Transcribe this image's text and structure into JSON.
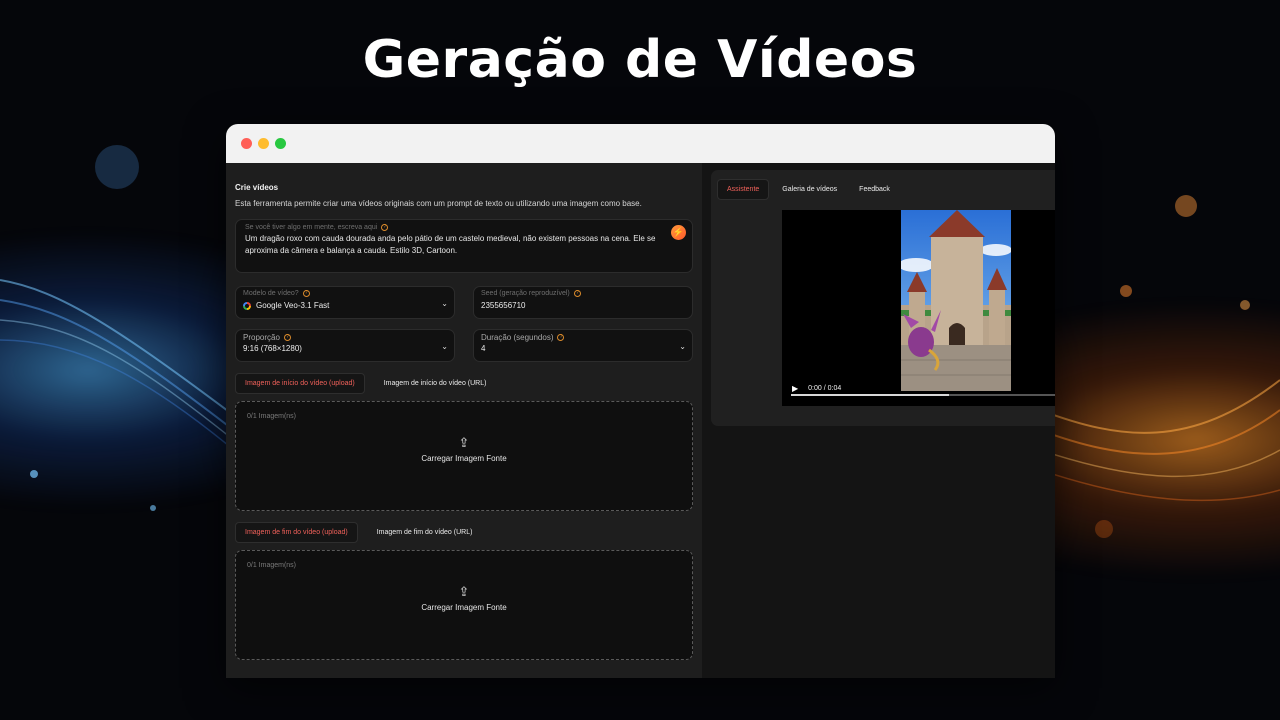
{
  "page": {
    "headline": "Geração de Vídeos"
  },
  "colors": {
    "accent": "#f0615a",
    "background": "#1e1e1e",
    "magic_button": "#ff6a2e"
  },
  "left": {
    "title": "Crie vídeos",
    "description": "Esta ferramenta permite criar uma vídeos originais com um prompt de texto ou utilizando uma imagem como base.",
    "prompt": {
      "label": "Se você tiver algo em mente, escreva aqui",
      "value": "Um dragão roxo com cauda dourada anda pelo pátio de um castelo medieval, não existem pessoas na cena. Ele se aproxima da câmera e balança a cauda. Estilo 3D, Cartoon.",
      "magic_icon": "sparkle-icon"
    },
    "model": {
      "label": "Modelo de vídeo?",
      "value": "Google Veo-3.1 Fast",
      "icon": "google-icon"
    },
    "seed": {
      "label": "Seed (geração reproduzível)",
      "value": "2355656710"
    },
    "ratio": {
      "label": "Proporção",
      "value": "9:16 (768×1280)"
    },
    "duration": {
      "label": "Duração (segundos)",
      "value": "4"
    },
    "start_image": {
      "tab_upload": "Imagem de início do vídeo (upload)",
      "tab_url": "Imagem de início do vídeo (URL)",
      "count": "0/1 Imagem(ns)",
      "upload_label": "Carregar Imagem Fonte"
    },
    "end_image": {
      "tab_upload": "Imagem de fim do vídeo (upload)",
      "tab_url": "Imagem de fim do vídeo (URL)",
      "count": "0/1 Imagem(ns)",
      "upload_label": "Carregar Imagem Fonte"
    }
  },
  "right": {
    "tabs": [
      "Assistente",
      "Galeria de vídeos",
      "Feedback"
    ],
    "player": {
      "time": "0:00 / 0:04",
      "progress": 0.6
    }
  }
}
